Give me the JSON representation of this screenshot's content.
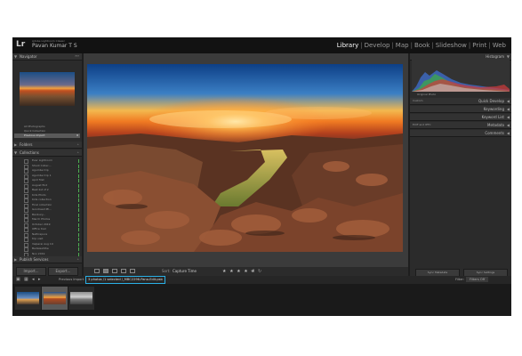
{
  "app": {
    "logo": "Lr",
    "identity_small": "Adobe Lightroom Classic",
    "identity_name": "Pavan Kumar T S"
  },
  "modules": [
    {
      "label": "Library",
      "active": true
    },
    {
      "label": "Develop",
      "active": false
    },
    {
      "label": "Map",
      "active": false
    },
    {
      "label": "Book",
      "active": false
    },
    {
      "label": "Slideshow",
      "active": false
    },
    {
      "label": "Print",
      "active": false
    },
    {
      "label": "Web",
      "active": false
    }
  ],
  "left_panel": {
    "navigator": {
      "title": "Navigator",
      "zoom": "FIT"
    },
    "catalog": [
      {
        "label": "All Photographs",
        "count": ""
      },
      {
        "label": "Quick Collection",
        "count": ""
      },
      {
        "label": "Previous Import",
        "count": "8"
      }
    ],
    "folders_title": "Folders",
    "collections_title": "Collections",
    "collections": [
      "Ever Lightroom",
      "Shoot Collec...",
      "Agumbe trip",
      "Agumbe trip 1",
      "April first",
      "August find",
      "Best list of 2",
      "Kids Photo",
      "Kids collection",
      "Final collection",
      "Goodread Ph...",
      "Banbury...",
      "March Photos",
      "October 2019",
      "Office trail",
      "Nethrapura",
      "trip visit",
      "Valparai Aug 19",
      "Badaleshthe",
      "Nov 2019"
    ],
    "publish_title": "Publish Services",
    "import_label": "Import...",
    "export_label": "Export..."
  },
  "toolbar": {
    "sort_label": "Sort:",
    "sort_value": "Capture Time",
    "rating": "★ ★ ★ ★ ★"
  },
  "right_panel": {
    "histogram_title": "Histogram",
    "original_photo": "Original Photo",
    "quick_develop": "Quick Develop",
    "saved_preset": "Custom",
    "keywording": "Keywording",
    "keyword_list": "Keyword List",
    "metadata": "Metadata",
    "metadata_preset": "EXIF and IPTC",
    "comments": "Comments",
    "sync_metadata": "Sync Metadata",
    "sync_settings": "Sync Settings"
  },
  "filmstrip": {
    "previous_import": "Previous Import",
    "selection_info": "3 photos /1 selected /_MBC2296-Pano-Edit.psb",
    "filter_label": "Filter:",
    "filter_value": "Filters Off"
  },
  "colors": {
    "selection_outline": "#2ab0e6",
    "collection_marker": "#4caf50"
  }
}
